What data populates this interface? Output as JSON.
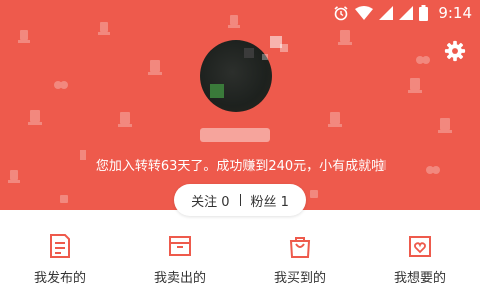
{
  "status_bar": {
    "time": "9:14",
    "icons": [
      "alarm-icon",
      "wifi-icon",
      "signal-icon",
      "signal-icon",
      "battery-icon"
    ]
  },
  "header": {
    "joined_text": "您加入转转63天了。成功赚到240元，小有成就啦",
    "settings_icon": "gear-icon"
  },
  "follow": {
    "following_label": "关注",
    "following_count": "0",
    "fans_label": "粉丝",
    "fans_count": "1"
  },
  "menu": {
    "items": [
      {
        "label": "我发布的",
        "icon": "document-icon"
      },
      {
        "label": "我卖出的",
        "icon": "box-icon"
      },
      {
        "label": "我买到的",
        "icon": "shopping-bag-icon"
      },
      {
        "label": "我想要的",
        "icon": "heart-card-icon"
      }
    ]
  },
  "colors": {
    "brand": "#ee5a4c",
    "icon": "#ee5a4c",
    "text": "#333333"
  }
}
